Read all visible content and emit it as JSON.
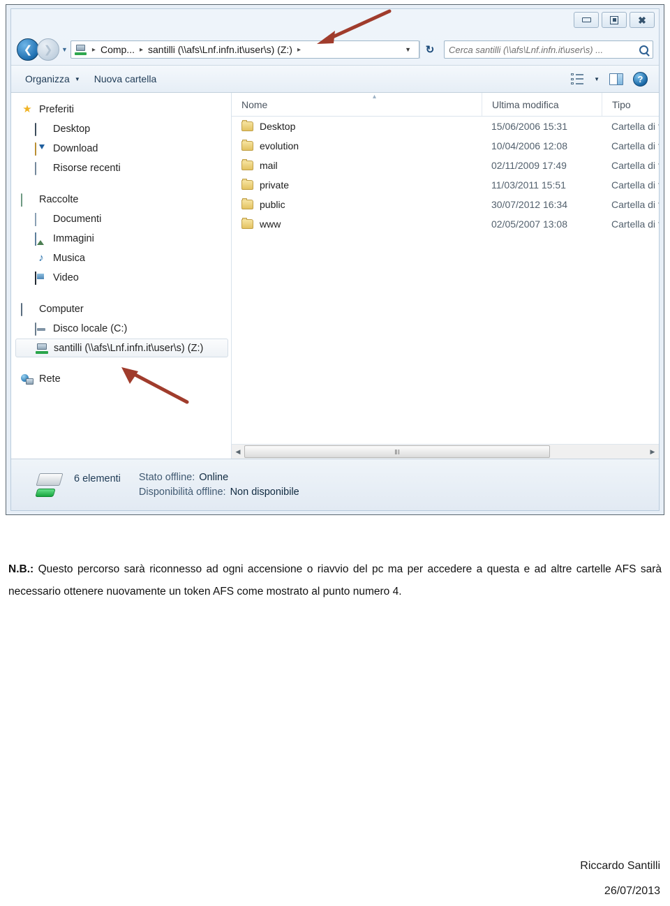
{
  "window": {
    "controls": {
      "minimize": "Riduci a icona",
      "restore": "Ripristina",
      "close": "Chiudi"
    },
    "address": {
      "breadcrumb": [
        "Comp...",
        "santilli (\\\\afs\\Lnf.infn.it\\user\\s) (Z:)"
      ],
      "separator": "▸",
      "dropdown_caret": "▼",
      "refresh": "↻"
    },
    "search": {
      "placeholder": "Cerca santilli (\\\\afs\\Lnf.infn.it\\user\\s) ..."
    },
    "toolbar": {
      "organizza": "Organizza",
      "organizza_caret": "▼",
      "nuova_cartella": "Nuova cartella",
      "views_caret": "▼",
      "help_glyph": "?"
    },
    "sidebar": {
      "groups": [
        {
          "header": {
            "label": "Preferiti",
            "icon": "star-icon"
          },
          "items": [
            {
              "label": "Desktop",
              "icon": "desktop-icon"
            },
            {
              "label": "Download",
              "icon": "download-icon"
            },
            {
              "label": "Risorse recenti",
              "icon": "recent-places-icon"
            }
          ]
        },
        {
          "header": {
            "label": "Raccolte",
            "icon": "libraries-icon"
          },
          "items": [
            {
              "label": "Documenti",
              "icon": "document-icon"
            },
            {
              "label": "Immagini",
              "icon": "pictures-icon"
            },
            {
              "label": "Musica",
              "icon": "music-icon"
            },
            {
              "label": "Video",
              "icon": "video-icon"
            }
          ]
        },
        {
          "header": {
            "label": "Computer",
            "icon": "computer-icon"
          },
          "items": [
            {
              "label": "Disco locale (C:)",
              "icon": "hard-disk-icon",
              "selected": false
            },
            {
              "label": "santilli (\\\\afs\\Lnf.infn.it\\user\\s) (Z:)",
              "icon": "network-drive-icon",
              "selected": true
            }
          ]
        },
        {
          "header": {
            "label": "Rete",
            "icon": "network-icon"
          },
          "items": []
        }
      ]
    },
    "filelist": {
      "columns": [
        "Nome",
        "Ultima modifica",
        "Tipo"
      ],
      "sort_indicator": "▴",
      "rows": [
        {
          "name": "Desktop",
          "modified": "15/06/2006 15:31",
          "type": "Cartella di file"
        },
        {
          "name": "evolution",
          "modified": "10/04/2006 12:08",
          "type": "Cartella di file"
        },
        {
          "name": "mail",
          "modified": "02/11/2009 17:49",
          "type": "Cartella di file"
        },
        {
          "name": "private",
          "modified": "11/03/2011 15:51",
          "type": "Cartella di file"
        },
        {
          "name": "public",
          "modified": "30/07/2012 16:34",
          "type": "Cartella di file"
        },
        {
          "name": "www",
          "modified": "02/05/2007 13:08",
          "type": "Cartella di file"
        }
      ]
    },
    "statusbar": {
      "item_count": "6 elementi",
      "offline_state_key": "Stato offline:",
      "offline_state_value": "Online",
      "offline_availability_key": "Disponibilità offline:",
      "offline_availability_value": "Non disponibile"
    }
  },
  "annotations": {
    "arrow_color": "#a03c2c",
    "arrows": [
      {
        "name": "arrow-to-address-bar",
        "points_at": "address-bar-path"
      },
      {
        "name": "arrow-to-mapped-drive",
        "points_at": "sidebar-item-mapped-drive"
      }
    ]
  },
  "caption": {
    "prefix": "N.B.:",
    "text": " Questo percorso sarà riconnesso ad ogni accensione o riavvio del pc ma per accedere a questa e ad altre cartelle AFS sarà necessario ottenere nuovamente un token AFS come mostrato al punto numero 4."
  },
  "footer": {
    "author": "Riccardo Santilli",
    "date": "26/07/2013"
  }
}
